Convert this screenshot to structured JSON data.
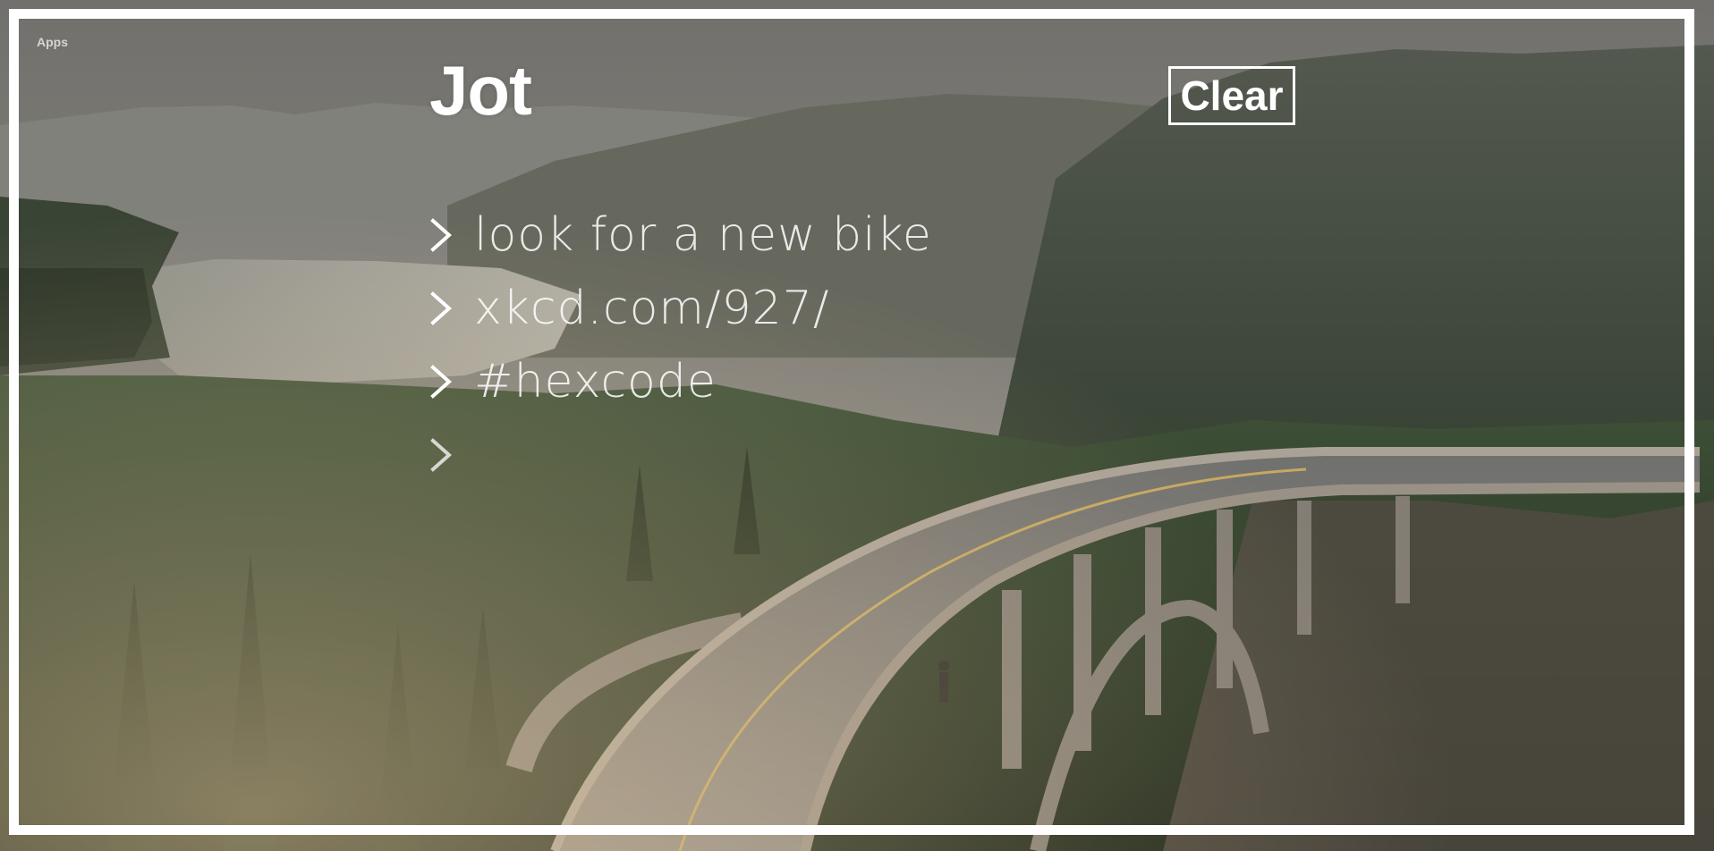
{
  "header": {
    "apps_label": "Apps",
    "app_title": "Jot",
    "clear_label": "Clear"
  },
  "notes": [
    {
      "text": "look for a new bike"
    },
    {
      "text": "xkcd.com/927/"
    },
    {
      "text": "#hexcode"
    },
    {
      "text": ""
    }
  ],
  "icons": {
    "note_marker": "chevron-right-icon"
  },
  "colors": {
    "frame": "#ffffff",
    "text": "#ffffff"
  }
}
